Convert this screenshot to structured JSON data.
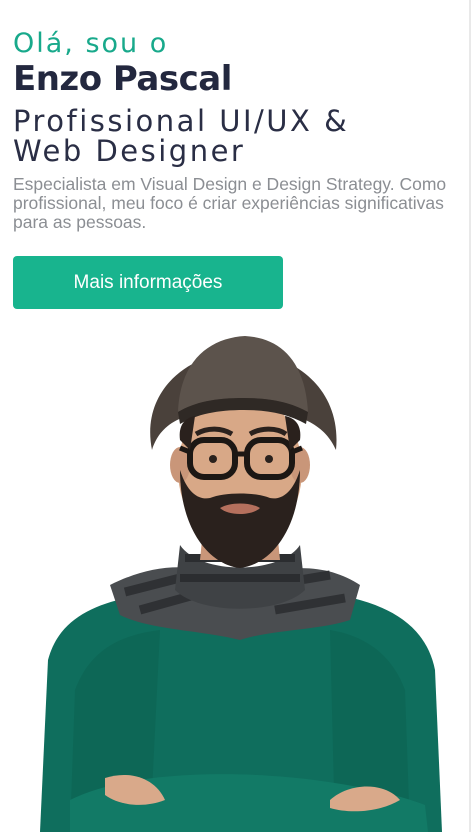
{
  "hero": {
    "greeting": "Olá, sou o",
    "name": "Enzo Pascal",
    "role_line1": "Profissional UI/UX &",
    "role_line2": "Web Designer",
    "description": "Especialista em Visual Design e Design Strategy. Como profissional, meu foco é criar experiências significativas para as pessoas.",
    "cta_label": "Mais informações"
  },
  "colors": {
    "accent": "#18b48e",
    "greeting": "#18a98b",
    "heading": "#23283f",
    "body_text": "#8b8e93"
  }
}
